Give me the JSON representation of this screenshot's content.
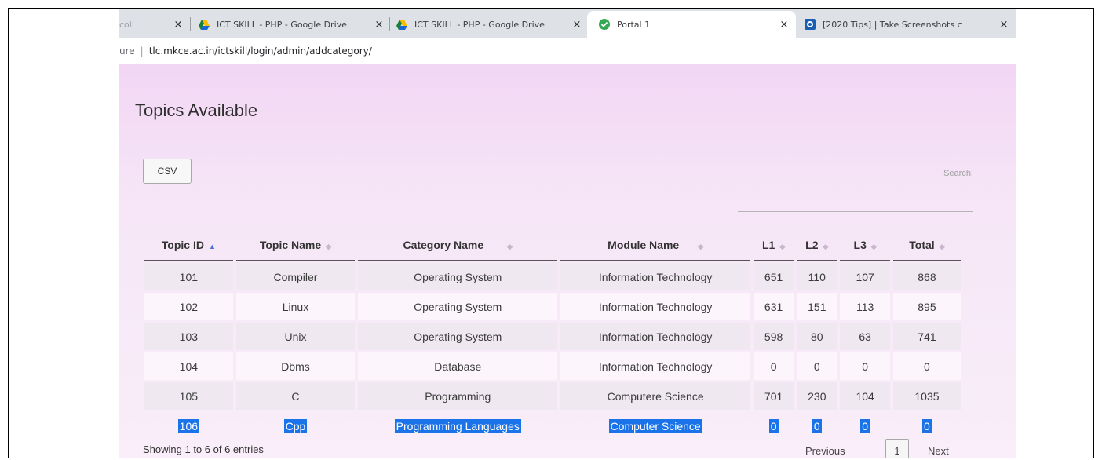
{
  "browser": {
    "tabs": [
      {
        "title": "coll",
        "close": "×",
        "icon": "none"
      },
      {
        "title": "ICT SKILL - PHP - Google Drive",
        "close": "×",
        "icon": "google-drive-icon"
      },
      {
        "title": "ICT SKILL - PHP - Google Drive",
        "close": "×",
        "icon": "google-drive-icon"
      },
      {
        "title": "Portal 1",
        "close": "×",
        "icon": "check-circle-icon",
        "active": true
      },
      {
        "title": "[2020 Tips] | Take Screenshots c",
        "close": "×",
        "icon": "site-icon"
      }
    ],
    "address": {
      "security": "ure",
      "url": "tlc.mkce.ac.in/ictskill/login/admin/addcategory/"
    }
  },
  "page": {
    "title": "Topics Available",
    "csv_label": "CSV",
    "search_label": "Search:",
    "search_value": ""
  },
  "table": {
    "columns": [
      "Topic ID",
      "Topic Name",
      "Category Name",
      "Module Name",
      "L1",
      "L2",
      "L3",
      "Total"
    ],
    "sorted_column": "Topic ID",
    "rows": [
      [
        "101",
        "Compiler",
        "Operating System",
        "Information Technology",
        "651",
        "110",
        "107",
        "868"
      ],
      [
        "102",
        "Linux",
        "Operating System",
        "Information Technology",
        "631",
        "151",
        "113",
        "895"
      ],
      [
        "103",
        "Unix",
        "Operating System",
        "Information Technology",
        "598",
        "80",
        "63",
        "741"
      ],
      [
        "104",
        "Dbms",
        "Database",
        "Information Technology",
        "0",
        "0",
        "0",
        "0"
      ],
      [
        "105",
        "C",
        "Programming",
        "Computere Science",
        "701",
        "230",
        "104",
        "1035"
      ],
      [
        "106",
        "Cpp",
        "Programming Languages",
        "Computer Science",
        "0",
        "0",
        "0",
        "0"
      ]
    ],
    "selected_row": 5
  },
  "footer": {
    "info": "Showing 1 to 6 of 6 entries",
    "previous": "Previous",
    "page": "1",
    "next": "Next"
  },
  "colors": {
    "accent": "#1a73e8",
    "page_bg": "#f4def5"
  }
}
